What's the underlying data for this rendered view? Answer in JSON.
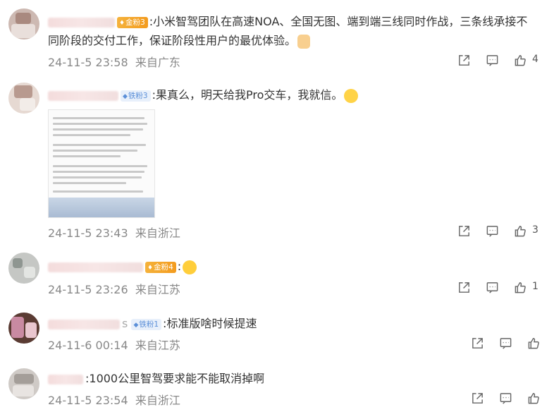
{
  "comments": [
    {
      "badge": "金粉3",
      "text": ":小米智驾团队在高速NOA、全国无图、端到端三线同时作战，三条线承接不",
      "text2": "同阶段的交付工作，保证阶段性用户的最优体验。",
      "emoji": "thumbs-up-emoji",
      "time": "24-11-5 23:58",
      "location": "来自广东",
      "likes": "4"
    },
    {
      "badge": "铁粉3",
      "text": ":果真么，明天给我Pro交车，我就信。",
      "emoji": "crying-emoji",
      "time": "24-11-5 23:43",
      "location": "来自浙江",
      "likes": "3"
    },
    {
      "badge": "金粉4",
      "text": ":",
      "emoji": "tongue-emoji",
      "time": "24-11-5 23:26",
      "location": "来自江苏",
      "likes": "1"
    },
    {
      "name_suffix": "s",
      "badge": "铁粉1",
      "text": ":标准版啥时候提速",
      "time": "24-11-6 00:14",
      "location": "来自江苏",
      "likes": ""
    },
    {
      "text": ":1000公里智驾要求能不能取消掉啊",
      "time": "24-11-5 23:54",
      "location": "来自浙江",
      "likes": ""
    }
  ],
  "icons": {
    "share": "share-icon",
    "comment": "comment-icon",
    "like": "like-icon"
  }
}
